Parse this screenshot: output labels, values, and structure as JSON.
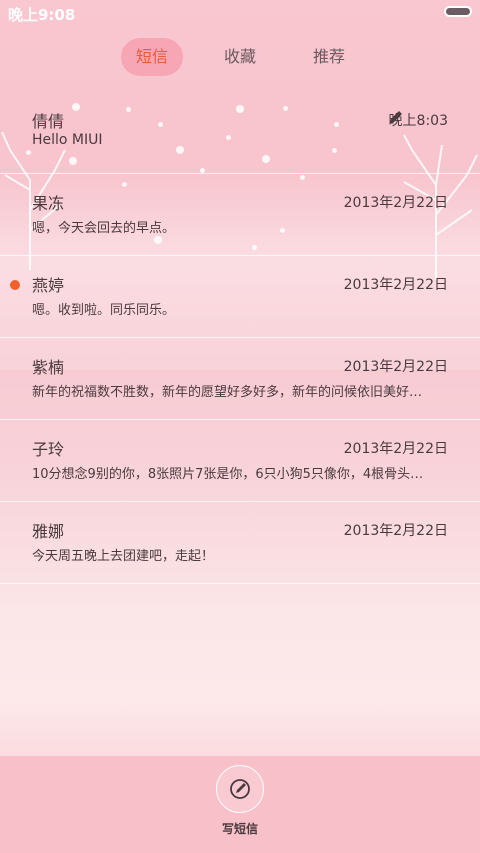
{
  "status_bar": {
    "time": "晚上9:08",
    "battery_icon": "battery-icon"
  },
  "tabs": [
    {
      "label": "短信",
      "active": true
    },
    {
      "label": "收藏",
      "active": false
    },
    {
      "label": "推荐",
      "active": false
    }
  ],
  "messages": [
    {
      "name": "倩倩",
      "date": "晚上8:03",
      "preview": "Hello MIUI",
      "draft": true,
      "unread": false
    },
    {
      "name": "果冻",
      "date": "2013年2月22日",
      "preview": "嗯，今天会回去的早点。",
      "draft": false,
      "unread": false
    },
    {
      "name": "燕婷",
      "date": "2013年2月22日",
      "preview": "嗯。收到啦。同乐同乐。",
      "draft": false,
      "unread": true
    },
    {
      "name": "紫楠",
      "date": "2013年2月22日",
      "preview": "新年的祝福数不胜数，新年的愿望好多好多，新年的问候依旧美好…",
      "draft": false,
      "unread": false
    },
    {
      "name": "子玲",
      "date": "2013年2月22日",
      "preview": "10分想念9别的你，8张照片7张是你，6只小狗5只像你，4根骨头…",
      "draft": false,
      "unread": false
    },
    {
      "name": "雅娜",
      "date": "2013年2月22日",
      "preview": "今天周五晚上去团建吧，走起！",
      "draft": false,
      "unread": false
    }
  ],
  "bottom_bar": {
    "compose_label": "写短信",
    "compose_icon": "compose-icon"
  },
  "colors": {
    "accent": "#ea5a38",
    "unread_dot": "#f0622d",
    "tab_active_bg": "#f7a6b5",
    "bottom_bar_bg": "#f8c1ca"
  }
}
